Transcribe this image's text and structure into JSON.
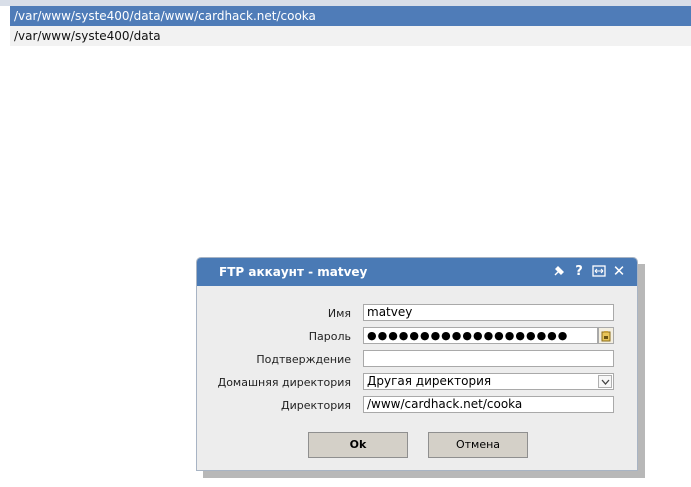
{
  "paths": [
    {
      "text": "/var/www/syste400/data/www/cardhack.net/cooka",
      "selected": true
    },
    {
      "text": "/var/www/syste400/data",
      "selected": false
    }
  ],
  "dialog": {
    "title": "FTP аккаунт - matvey",
    "icons": [
      "pin-icon",
      "help-icon",
      "maximize-icon",
      "close-icon"
    ],
    "help_glyph": "?",
    "close_glyph": "✕",
    "fields": {
      "name_label": "Имя",
      "name_value": "matvey",
      "password_label": "Пароль",
      "password_value": "●●●●●●●●●●●●●●●●●●●",
      "confirm_label": "Подтверждение",
      "confirm_value": "",
      "home_dir_label": "Домашняя директория",
      "home_dir_value": "Другая директория",
      "dir_label": "Директория",
      "dir_value": "/www/cardhack.net/cooka"
    },
    "buttons": {
      "ok_label": "Ok",
      "cancel_label": "Отмена"
    }
  },
  "colors": {
    "header": "#4a7ab5",
    "selected_row": "#4f7cb8"
  }
}
